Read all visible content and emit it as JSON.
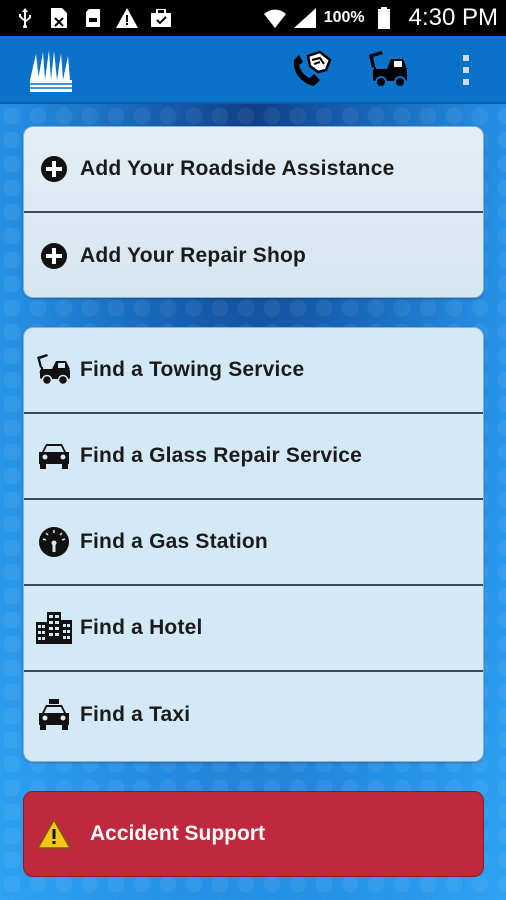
{
  "status_bar": {
    "battery_percent": "100%",
    "time": "4:30 PM",
    "icons": [
      "usb-icon",
      "sim-icon",
      "sd-card-icon",
      "warning-icon",
      "briefcase-icon",
      "wifi-icon",
      "signal-icon",
      "battery-icon"
    ]
  },
  "app_bar": {
    "icons": [
      "logo-icon",
      "phone-handshake-icon",
      "tow-truck-icon",
      "overflow-menu-icon"
    ]
  },
  "add_section": {
    "items": [
      {
        "label": "Add Your Roadside Assistance",
        "icon": "add-circle-icon"
      },
      {
        "label": "Add Your Repair Shop",
        "icon": "add-circle-icon"
      }
    ]
  },
  "find_section": {
    "items": [
      {
        "label": "Find a Towing Service",
        "icon": "tow-truck-icon"
      },
      {
        "label": "Find a Glass Repair Service",
        "icon": "car-icon"
      },
      {
        "label": "Find a Gas Station",
        "icon": "fuel-gauge-icon"
      },
      {
        "label": "Find a Hotel",
        "icon": "buildings-icon"
      },
      {
        "label": "Find a Taxi",
        "icon": "taxi-icon"
      }
    ]
  },
  "accident": {
    "label": "Accident Support",
    "icon": "warning-icon",
    "color": "#c0283e"
  },
  "colors": {
    "app_bar": "#0a72c8",
    "card": "#d4e9f7",
    "accent": "#1e86d6"
  }
}
